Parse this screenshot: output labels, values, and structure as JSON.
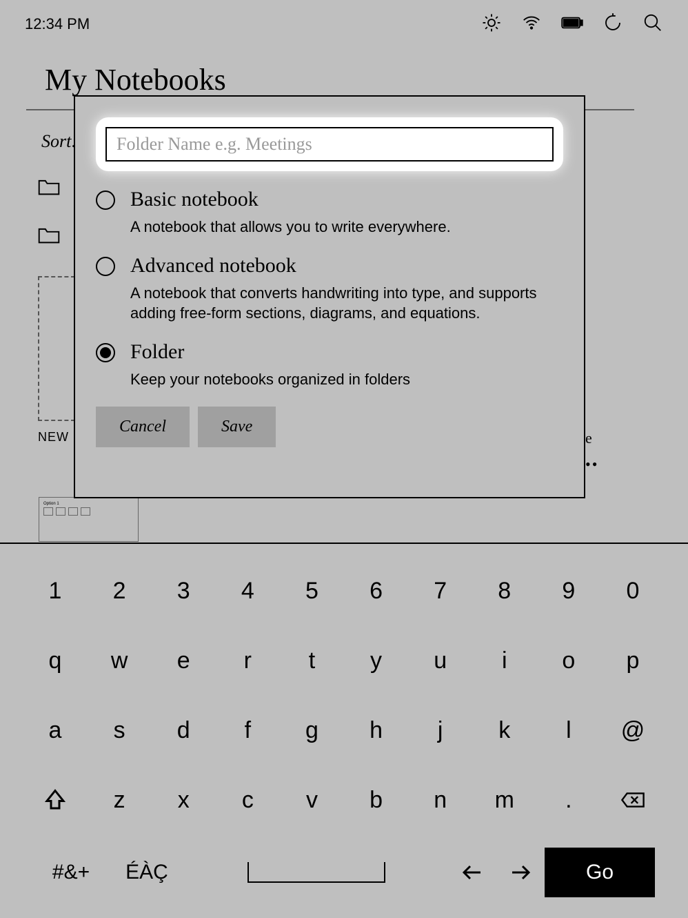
{
  "status": {
    "time": "12:34 PM"
  },
  "page": {
    "title": "My Notebooks",
    "sort_label": "Sort:",
    "new_label": "NEW"
  },
  "right_peek": "e",
  "dialog": {
    "input_placeholder": "Folder Name e.g. Meetings",
    "options": [
      {
        "title": "Basic notebook",
        "desc": "A notebook that allows you to write everywhere.",
        "selected": false
      },
      {
        "title": "Advanced notebook",
        "desc": "A notebook that converts handwriting into type, and supports adding free-form sections, diagrams, and equations.",
        "selected": false
      },
      {
        "title": "Folder",
        "desc": "Keep your notebooks organized in folders",
        "selected": true
      }
    ],
    "cancel": "Cancel",
    "save": "Save"
  },
  "keyboard": {
    "row1": [
      "1",
      "2",
      "3",
      "4",
      "5",
      "6",
      "7",
      "8",
      "9",
      "0"
    ],
    "row2": [
      "q",
      "w",
      "e",
      "r",
      "t",
      "y",
      "u",
      "i",
      "o",
      "p"
    ],
    "row3": [
      "a",
      "s",
      "d",
      "f",
      "g",
      "h",
      "j",
      "k",
      "l",
      "@"
    ],
    "row4_letters": [
      "z",
      "x",
      "c",
      "v",
      "b",
      "n",
      "m",
      "."
    ],
    "sym": "#&+",
    "accent": "ÉÀÇ",
    "go": "Go"
  }
}
